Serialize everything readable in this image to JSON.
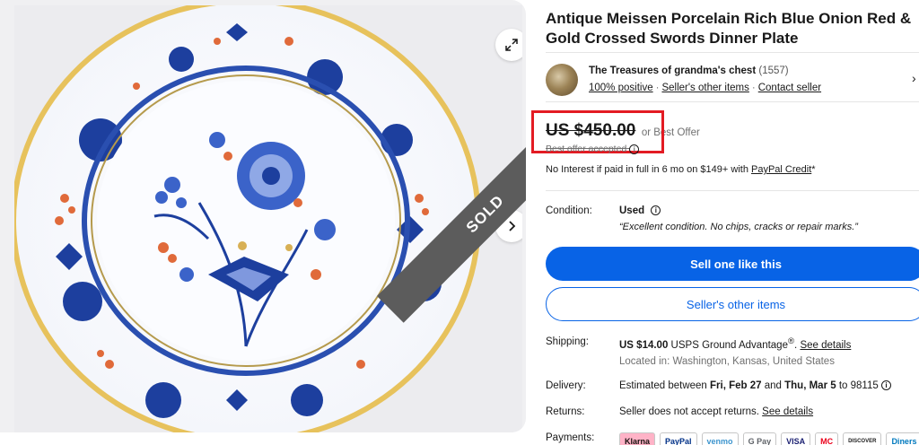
{
  "gallery": {
    "sold_label": "SOLD",
    "expand_icon": "expand-arrows-icon",
    "next_icon": "chevron-right-icon"
  },
  "listing": {
    "title": "Antique Meissen Porcelain Rich Blue Onion Red & Gold Crossed Swords Dinner Plate"
  },
  "seller": {
    "name": "The Treasures of grandma's chest",
    "feedback_count": "(1557)",
    "positive": "100% positive",
    "other_items": "Seller's other items",
    "contact": "Contact seller"
  },
  "price": {
    "amount": "US $450.00",
    "or_best_offer": "or Best Offer",
    "best_offer_accepted": "Best offer accepted",
    "interest_text": "No Interest if paid in full in 6 mo on $149+ with ",
    "paypal_credit": "PayPal Credit",
    "asterisk": "*"
  },
  "condition": {
    "label": "Condition:",
    "value": "Used",
    "note": "“Excellent condition. No chips, cracks or repair marks.”"
  },
  "buttons": {
    "sell_one": "Sell one like this",
    "seller_other_items": "Seller's other items"
  },
  "shipping": {
    "label": "Shipping:",
    "cost": "US $14.00",
    "service": " USPS Ground Advantage",
    "reg": "®",
    "dot": ". ",
    "see_details": "See details",
    "location": "Located in: Washington, Kansas, United States"
  },
  "delivery": {
    "label": "Delivery:",
    "prefix": "Estimated between ",
    "start": "Fri, Feb 27",
    "and": " and ",
    "end": "Thu, Mar 5",
    "suffix": " to 98115 "
  },
  "returns": {
    "label": "Returns:",
    "text": "Seller does not accept returns. ",
    "see_details": "See details"
  },
  "payments": {
    "label": "Payments:",
    "methods": [
      "Klarna",
      "PayPal",
      "venmo",
      "G Pay",
      "VISA",
      "MC",
      "DISCOVER",
      "Diners"
    ]
  },
  "colors": {
    "accent_blue": "#0863e6",
    "highlight_red": "#e31b23",
    "sold_banner": "#5c5c5c"
  }
}
